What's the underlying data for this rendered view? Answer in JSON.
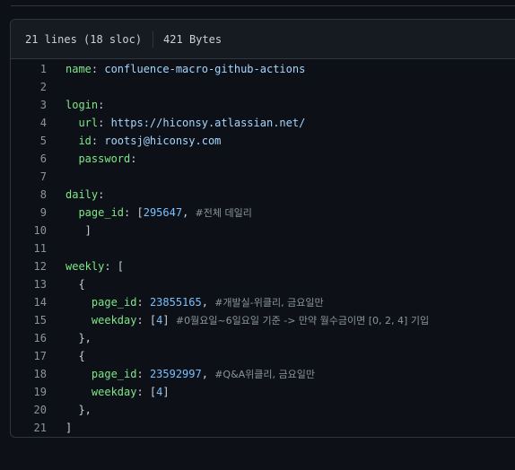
{
  "file_header": {
    "lines_info": "21 lines (18 sloc)",
    "size_info": "421 Bytes"
  },
  "code_lines": [
    {
      "num": "1",
      "tokens": [
        {
          "t": "name",
          "c": "k"
        },
        {
          "t": ": ",
          "c": "p"
        },
        {
          "t": "confluence-macro-github-actions",
          "c": "s"
        }
      ]
    },
    {
      "num": "2",
      "tokens": []
    },
    {
      "num": "3",
      "tokens": [
        {
          "t": "login",
          "c": "k"
        },
        {
          "t": ":",
          "c": "p"
        }
      ]
    },
    {
      "num": "4",
      "tokens": [
        {
          "t": "  url",
          "c": "k"
        },
        {
          "t": ": ",
          "c": "p"
        },
        {
          "t": "https://hiconsy.atlassian.net/",
          "c": "s"
        }
      ]
    },
    {
      "num": "5",
      "tokens": [
        {
          "t": "  id",
          "c": "k"
        },
        {
          "t": ": ",
          "c": "p"
        },
        {
          "t": "rootsj@hiconsy.com",
          "c": "s"
        }
      ]
    },
    {
      "num": "6",
      "tokens": [
        {
          "t": "  password",
          "c": "k"
        },
        {
          "t": ":",
          "c": "p"
        }
      ]
    },
    {
      "num": "7",
      "tokens": []
    },
    {
      "num": "8",
      "tokens": [
        {
          "t": "daily",
          "c": "k"
        },
        {
          "t": ":",
          "c": "p"
        }
      ]
    },
    {
      "num": "9",
      "tokens": [
        {
          "t": "  page_id",
          "c": "k"
        },
        {
          "t": ": ",
          "c": "p"
        },
        {
          "t": "[",
          "c": "p"
        },
        {
          "t": "295647",
          "c": "n"
        },
        {
          "t": ", ",
          "c": "p"
        },
        {
          "t": "#전체 데일리",
          "c": "c"
        }
      ]
    },
    {
      "num": "10",
      "tokens": [
        {
          "t": "   ]",
          "c": "p"
        }
      ]
    },
    {
      "num": "11",
      "tokens": []
    },
    {
      "num": "12",
      "tokens": [
        {
          "t": "weekly",
          "c": "k"
        },
        {
          "t": ": [",
          "c": "p"
        }
      ]
    },
    {
      "num": "13",
      "tokens": [
        {
          "t": "  {",
          "c": "p"
        }
      ]
    },
    {
      "num": "14",
      "tokens": [
        {
          "t": "    page_id",
          "c": "k"
        },
        {
          "t": ": ",
          "c": "p"
        },
        {
          "t": "23855165",
          "c": "n"
        },
        {
          "t": ", ",
          "c": "p"
        },
        {
          "t": "#개발실-위클리, 금요일만",
          "c": "c"
        }
      ]
    },
    {
      "num": "15",
      "tokens": [
        {
          "t": "    weekday",
          "c": "k"
        },
        {
          "t": ": [",
          "c": "p"
        },
        {
          "t": "4",
          "c": "n"
        },
        {
          "t": "] ",
          "c": "p"
        },
        {
          "t": "#0월요일~6일요일 기준 -> 만약 월수금이면 [0, 2, 4] 기입",
          "c": "c"
        }
      ]
    },
    {
      "num": "16",
      "tokens": [
        {
          "t": "  },",
          "c": "p"
        }
      ]
    },
    {
      "num": "17",
      "tokens": [
        {
          "t": "  {",
          "c": "p"
        }
      ]
    },
    {
      "num": "18",
      "tokens": [
        {
          "t": "    page_id",
          "c": "k"
        },
        {
          "t": ": ",
          "c": "p"
        },
        {
          "t": "23592997",
          "c": "n"
        },
        {
          "t": ", ",
          "c": "p"
        },
        {
          "t": "#Q&A위클리, 금요일만",
          "c": "c"
        }
      ]
    },
    {
      "num": "19",
      "tokens": [
        {
          "t": "    weekday",
          "c": "k"
        },
        {
          "t": ": [",
          "c": "p"
        },
        {
          "t": "4",
          "c": "n"
        },
        {
          "t": "]",
          "c": "p"
        }
      ]
    },
    {
      "num": "20",
      "tokens": [
        {
          "t": "  },",
          "c": "p"
        }
      ]
    },
    {
      "num": "21",
      "tokens": [
        {
          "t": "]",
          "c": "p"
        }
      ]
    }
  ]
}
